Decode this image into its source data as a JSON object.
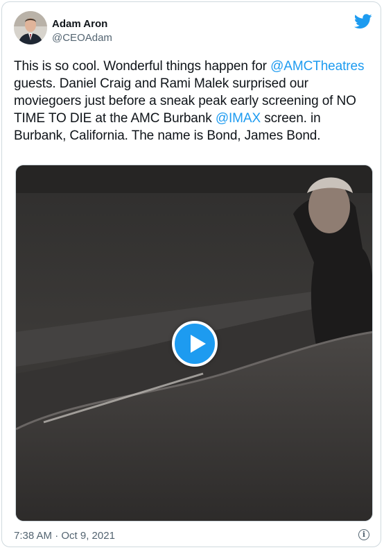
{
  "author": {
    "name": "Adam Aron",
    "handle": "@CEOAdam"
  },
  "tweet": {
    "segments": [
      {
        "type": "text",
        "value": "This is so cool. Wonderful things happen for "
      },
      {
        "type": "mention",
        "value": "@AMCTheatres"
      },
      {
        "type": "text",
        "value": " guests. Daniel Craig and Rami Malek surprised our moviegoers just before a sneak peak early screening of NO TIME TO DIE at the AMC Burbank "
      },
      {
        "type": "mention",
        "value": "@IMAX"
      },
      {
        "type": "text",
        "value": " screen. in Burbank, California. The name is Bond, James Bond."
      }
    ]
  },
  "media": {
    "type": "video",
    "play_icon": "play-icon"
  },
  "footer": {
    "timestamp": "7:38 AM · Oct 9, 2021",
    "info_icon": "info-icon"
  },
  "colors": {
    "accent": "#1d9bf0",
    "text": "#0f1419",
    "secondary": "#536471",
    "border": "#cfd9de"
  }
}
